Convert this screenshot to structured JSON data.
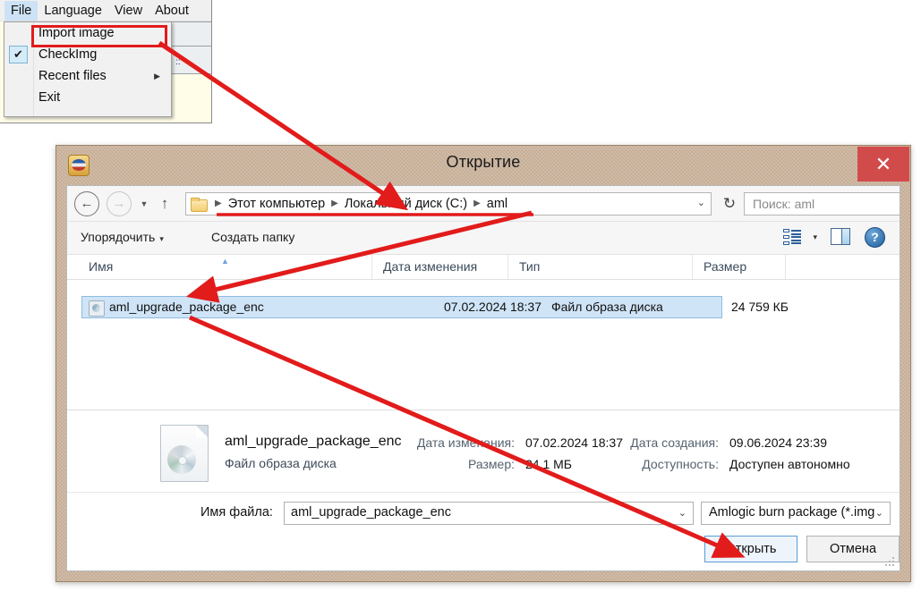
{
  "app": {
    "menubar": [
      {
        "label": "File",
        "active": true
      },
      {
        "label": "Language",
        "active": false
      },
      {
        "label": "View",
        "active": false
      },
      {
        "label": "About",
        "active": false
      }
    ],
    "file_menu": [
      {
        "label": "Import image",
        "checked": false,
        "submenu": false,
        "highlighted": true
      },
      {
        "label": "CheckImg",
        "checked": true,
        "submenu": false,
        "highlighted": false
      },
      {
        "label": "Recent files",
        "checked": false,
        "submenu": true,
        "highlighted": false
      },
      {
        "label": "Exit",
        "checked": false,
        "submenu": false,
        "highlighted": false
      }
    ],
    "check_glyph": "✔",
    "submenu_glyph": "▶"
  },
  "dialog": {
    "title": "Открытие",
    "close_glyph": "✕",
    "nav": {
      "back_glyph": "←",
      "forward_glyph": "→",
      "history_glyph": "▼",
      "up_glyph": "↑",
      "refresh_glyph": "↻",
      "breadcrumbs": [
        "Этот компьютер",
        "Локальный диск (C:)",
        "aml"
      ],
      "crumb_sep": "▶",
      "dropdown_glyph": "⌄"
    },
    "search": {
      "placeholder": "Поиск: aml"
    },
    "commandbar": {
      "organize": "Упорядочить",
      "new_folder": "Создать папку",
      "caret": "▾",
      "help_glyph": "?"
    },
    "columns": [
      {
        "label": "Имя"
      },
      {
        "label": "Дата изменения"
      },
      {
        "label": "Тип"
      },
      {
        "label": "Размер"
      },
      {
        "label": ""
      }
    ],
    "sort_caret": "▲",
    "files": [
      {
        "name": "aml_upgrade_package_enc",
        "date": "07.02.2024 18:37",
        "type": "Файл образа диска",
        "size": "24 759 КБ",
        "selected": true
      }
    ],
    "details": {
      "title": "aml_upgrade_package_enc",
      "subtitle": "Файл образа диска",
      "modified_label": "Дата изменения:",
      "modified_value": "07.02.2024 18:37",
      "size_label": "Размер:",
      "size_value": "24,1 МБ",
      "created_label": "Дата создания:",
      "created_value": "09.06.2024 23:39",
      "availability_label": "Доступность:",
      "availability_value": "Доступен автономно"
    },
    "footer": {
      "filename_label": "Имя файла:",
      "filename_value": "aml_upgrade_package_enc",
      "filter_value": "Amlogic burn package (*.img",
      "dropdown_glyph": "⌄",
      "open_button": "Открыть",
      "cancel_button": "Отмена"
    }
  },
  "annotations": {
    "accent_color": "#e21b1b",
    "highlight_color": "#e21b1b"
  },
  "colors": {
    "titlebar": "#cbb29a",
    "close_button": "#d24b4b",
    "selection": "#cfe4f7",
    "menu_active": "#cde3f5",
    "default_button_border": "#5b9bd5"
  }
}
